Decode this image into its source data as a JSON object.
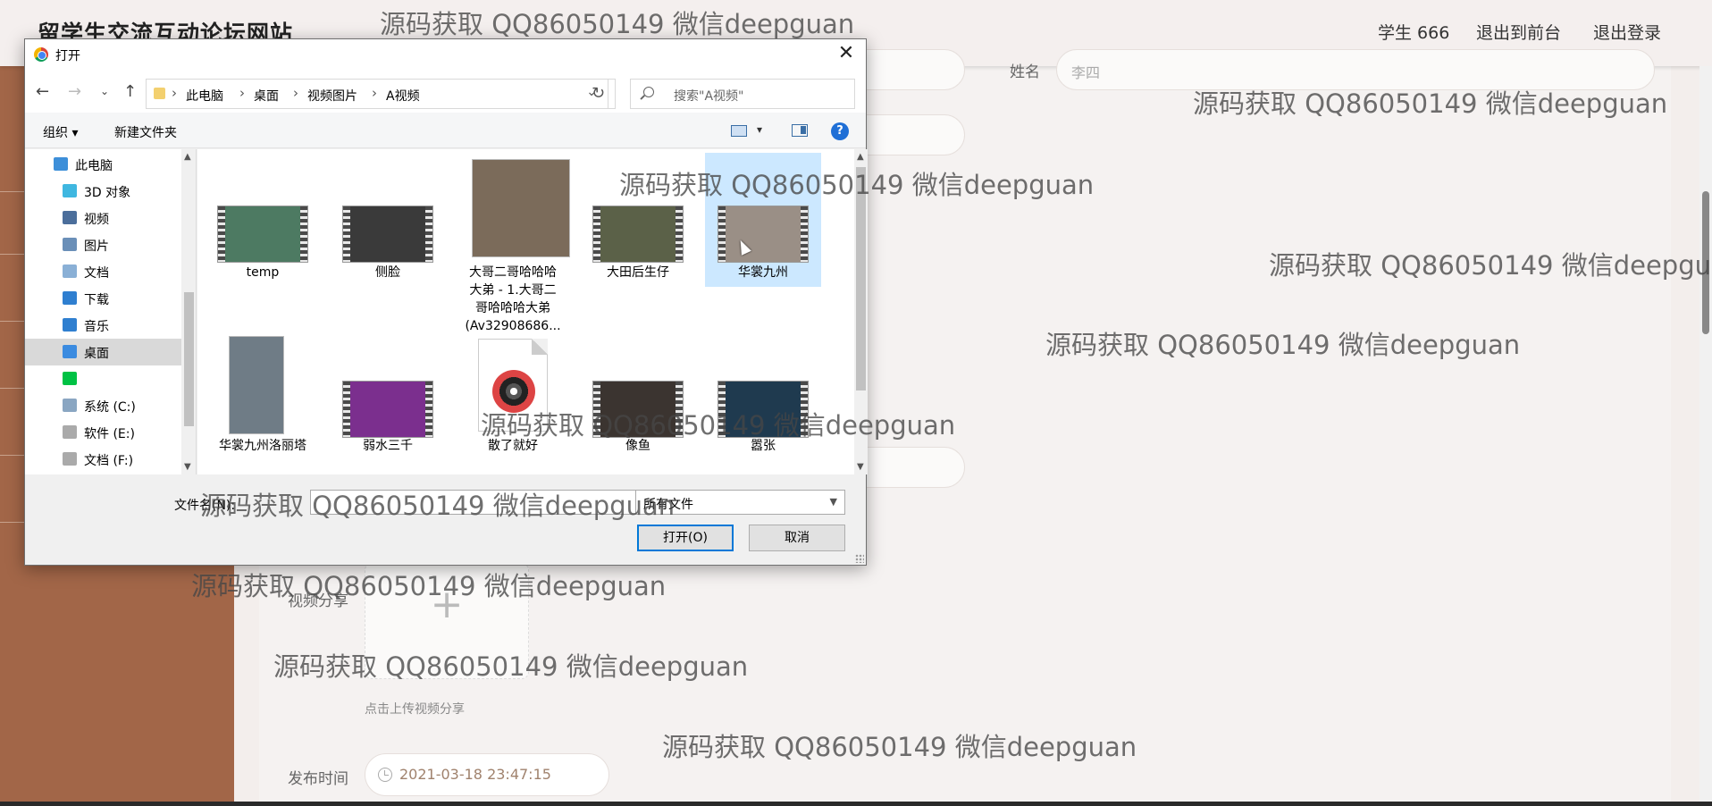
{
  "site": {
    "title": "留学生交流互动论坛网站",
    "nav": [
      "学生 666",
      "退出到前台",
      "退出登录"
    ]
  },
  "form": {
    "name_label": "姓名",
    "name_value": "李四",
    "video_label": "视频分享",
    "upload_plus": "+",
    "upload_hint": "点击上传视频分享",
    "publish_label": "发布时间",
    "publish_value": "2021-03-18 23:47:15"
  },
  "dialog": {
    "title": "打开",
    "close": "✕",
    "breadcrumb": [
      "此电脑",
      "桌面",
      "视频图片",
      "A视频"
    ],
    "search_placeholder": "搜索\"A视频\"",
    "organize": "组织 ▾",
    "new_folder": "新建文件夹",
    "help": "?",
    "nav_items": [
      {
        "label": "此电脑",
        "icon": "computer-icon",
        "color": "#3d8fd9"
      },
      {
        "label": "3D 对象",
        "icon": "cube-icon",
        "color": "#3fb7e0"
      },
      {
        "label": "视频",
        "icon": "video-folder-icon",
        "color": "#4b6e9b"
      },
      {
        "label": "图片",
        "icon": "picture-folder-icon",
        "color": "#6a8fb8"
      },
      {
        "label": "文档",
        "icon": "document-icon",
        "color": "#8ab0d6"
      },
      {
        "label": "下载",
        "icon": "download-icon",
        "color": "#2f7fd0"
      },
      {
        "label": "音乐",
        "icon": "music-icon",
        "color": "#2f7fd0"
      },
      {
        "label": "桌面",
        "icon": "desktop-icon",
        "color": "#3b8be0"
      },
      {
        "label": "",
        "icon": "iqiyi-icon",
        "color": "#00c244"
      },
      {
        "label": "系统 (C:)",
        "icon": "drive-icon",
        "color": "#8aa6c2"
      },
      {
        "label": "软件 (E:)",
        "icon": "drive-icon",
        "color": "#aaaaaa"
      },
      {
        "label": "文档 (F:)",
        "icon": "drive-icon",
        "color": "#aaaaaa"
      }
    ],
    "files": [
      {
        "name": "temp",
        "kind": "film",
        "color": "#4d7a62"
      },
      {
        "name": "侧脸",
        "kind": "film",
        "color": "#3a3a3a"
      },
      {
        "name": "大哥二哥哈哈哈\n大弟 - 1.大哥二\n哥哈哈哈大弟\n(Av32908686...",
        "kind": "photo",
        "color": "#7b6b5a"
      },
      {
        "name": "大田后生仔",
        "kind": "film",
        "color": "#5b6148"
      },
      {
        "name": "华裳九州",
        "kind": "film",
        "color": "#9a8f86"
      },
      {
        "name": "华裳九州洛丽塔",
        "kind": "photo",
        "color": "#6f7c86"
      },
      {
        "name": "弱水三千",
        "kind": "film",
        "color": "#7b2f8e"
      },
      {
        "name": "散了就好",
        "kind": "music",
        "color": "#d44444"
      },
      {
        "name": "像鱼",
        "kind": "film",
        "color": "#3b3430"
      },
      {
        "name": "嚣张",
        "kind": "film",
        "color": "#1f3a4f"
      }
    ],
    "filename_label": "文件名(N):",
    "filename_value": "",
    "filetype": "所有文件",
    "open_button": "打开(O)",
    "cancel_button": "取消"
  },
  "watermark": "源码获取 QQ86050149 微信deepguan"
}
